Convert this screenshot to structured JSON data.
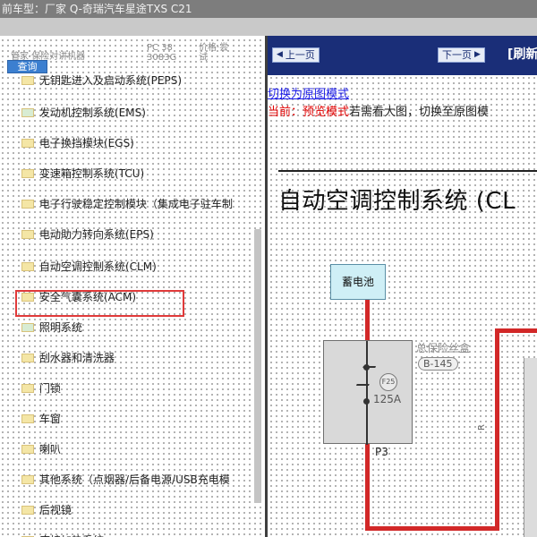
{
  "window": {
    "title": "前车型：厂家 Q-奇瑞汽车星途TXS C21"
  },
  "left_panel": {
    "header": {
      "col_a": "管家·保险对讲机器",
      "col_b": "PC 38 3083G",
      "col_c": "价格·尝 试"
    },
    "query_button": "查询",
    "tree_items": [
      {
        "label": "无钥匙进入及启动系统(PEPS)",
        "icon": "folder-icon",
        "color": "#f4e6a6",
        "partial": true
      },
      {
        "label": "发动机控制系统(EMS)",
        "icon": "folder-icon",
        "color": "#d8ecd3"
      },
      {
        "label": "电子换挡模块(EGS)",
        "icon": "folder-icon",
        "color": "#f4e6a6"
      },
      {
        "label": "变速箱控制系统(TCU)",
        "icon": "folder-icon",
        "color": "#f4e6a6"
      },
      {
        "label": "电子行驶稳定控制模块（集成电子驻车制",
        "icon": "folder-icon",
        "color": "#f4e6a6"
      },
      {
        "label": "电动助力转向系统(EPS)",
        "icon": "folder-icon",
        "color": "#f4e6a6"
      },
      {
        "label": "自动空调控制系统(CLM)",
        "icon": "folder-icon",
        "color": "#f4e6a6",
        "highlighted": true
      },
      {
        "label": "安全气囊系统(ACM)",
        "icon": "folder-icon",
        "color": "#f4e6a6"
      },
      {
        "label": "照明系统",
        "icon": "folder-icon",
        "color": "#d8ecd3"
      },
      {
        "label": "刮水器和清洗器",
        "icon": "folder-icon",
        "color": "#f4e6a6"
      },
      {
        "label": "门锁",
        "icon": "folder-icon",
        "color": "#f4e6a6"
      },
      {
        "label": "车窗",
        "icon": "folder-icon",
        "color": "#f4e6a6"
      },
      {
        "label": "喇叭",
        "icon": "folder-icon",
        "color": "#f4e6a6"
      },
      {
        "label": "其他系统（点烟器/后备电源/USB充电模",
        "icon": "folder-icon",
        "color": "#f4e6a6"
      },
      {
        "label": "后视镜",
        "icon": "folder-icon",
        "color": "#f4e6a6"
      },
      {
        "label": "座椅加热系统",
        "icon": "folder-icon",
        "color": "#f4e6a6",
        "partial": true
      }
    ]
  },
  "right_panel": {
    "nav": {
      "prev": "上一页",
      "next": "下一页",
      "extra": "[刷新"
    },
    "link_original": "切换为原图模式",
    "status_prefix": "当前：",
    "status_mode": "预览模式",
    "status_hint": "若需看大图，切换至原图模",
    "diagram_title": "自动空调控制系统 (CL",
    "battery_label": "蓄电池",
    "fuse_badge": "F25",
    "fuse_amp": "125A",
    "fuse_pin": "P3",
    "fusebox_label": "总保险丝盒",
    "fusebox_code": "B-145",
    "wire_code": "R",
    "wire_color": "#d22828"
  }
}
